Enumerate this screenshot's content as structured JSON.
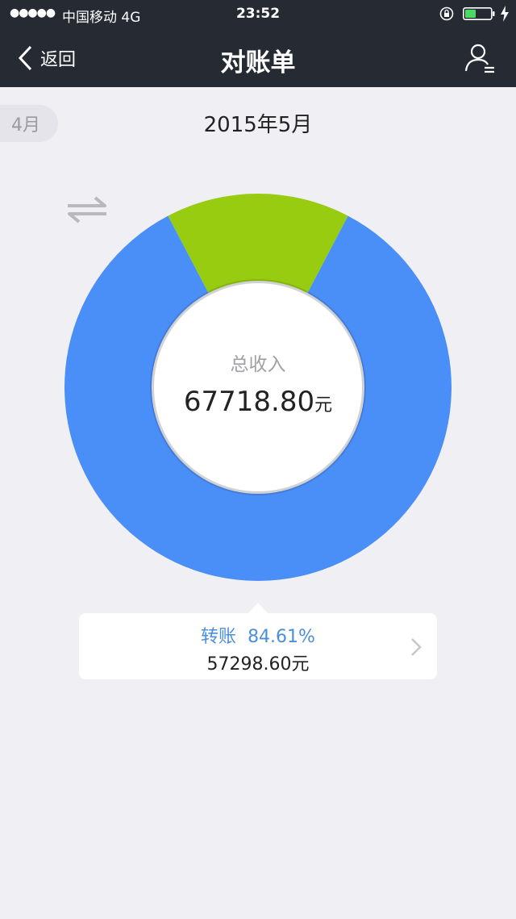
{
  "status_bar": {
    "signal": "●●●●●",
    "carrier": "中国移动  4G",
    "time": "23:52"
  },
  "nav": {
    "back_label": "返回",
    "title": "对账单"
  },
  "month_nav": {
    "prev_label": "4月",
    "current_label": "2015年5月"
  },
  "summary": {
    "label": "总收入",
    "amount": "67718.80",
    "unit": "元"
  },
  "colors": {
    "transfer": "#4a8ff7",
    "other": "#97cc11",
    "navbar": "#262a33",
    "accent_text": "#4a8fdc"
  },
  "chart_data": {
    "type": "pie",
    "donut": true,
    "slices": [
      {
        "name": "转账",
        "value": 84.61,
        "color": "#4a8ff7"
      },
      {
        "value": 15.39,
        "color": "#97cc11"
      }
    ]
  },
  "selected_item": {
    "name": "转账",
    "percent": "84.61%",
    "amount": "57298.60元"
  },
  "icons": [
    "chevron-left-icon",
    "user-icon",
    "lock-rotation-icon",
    "battery-icon",
    "charging-bolt-icon",
    "swap-arrows-icon",
    "chevron-right-icon"
  ]
}
